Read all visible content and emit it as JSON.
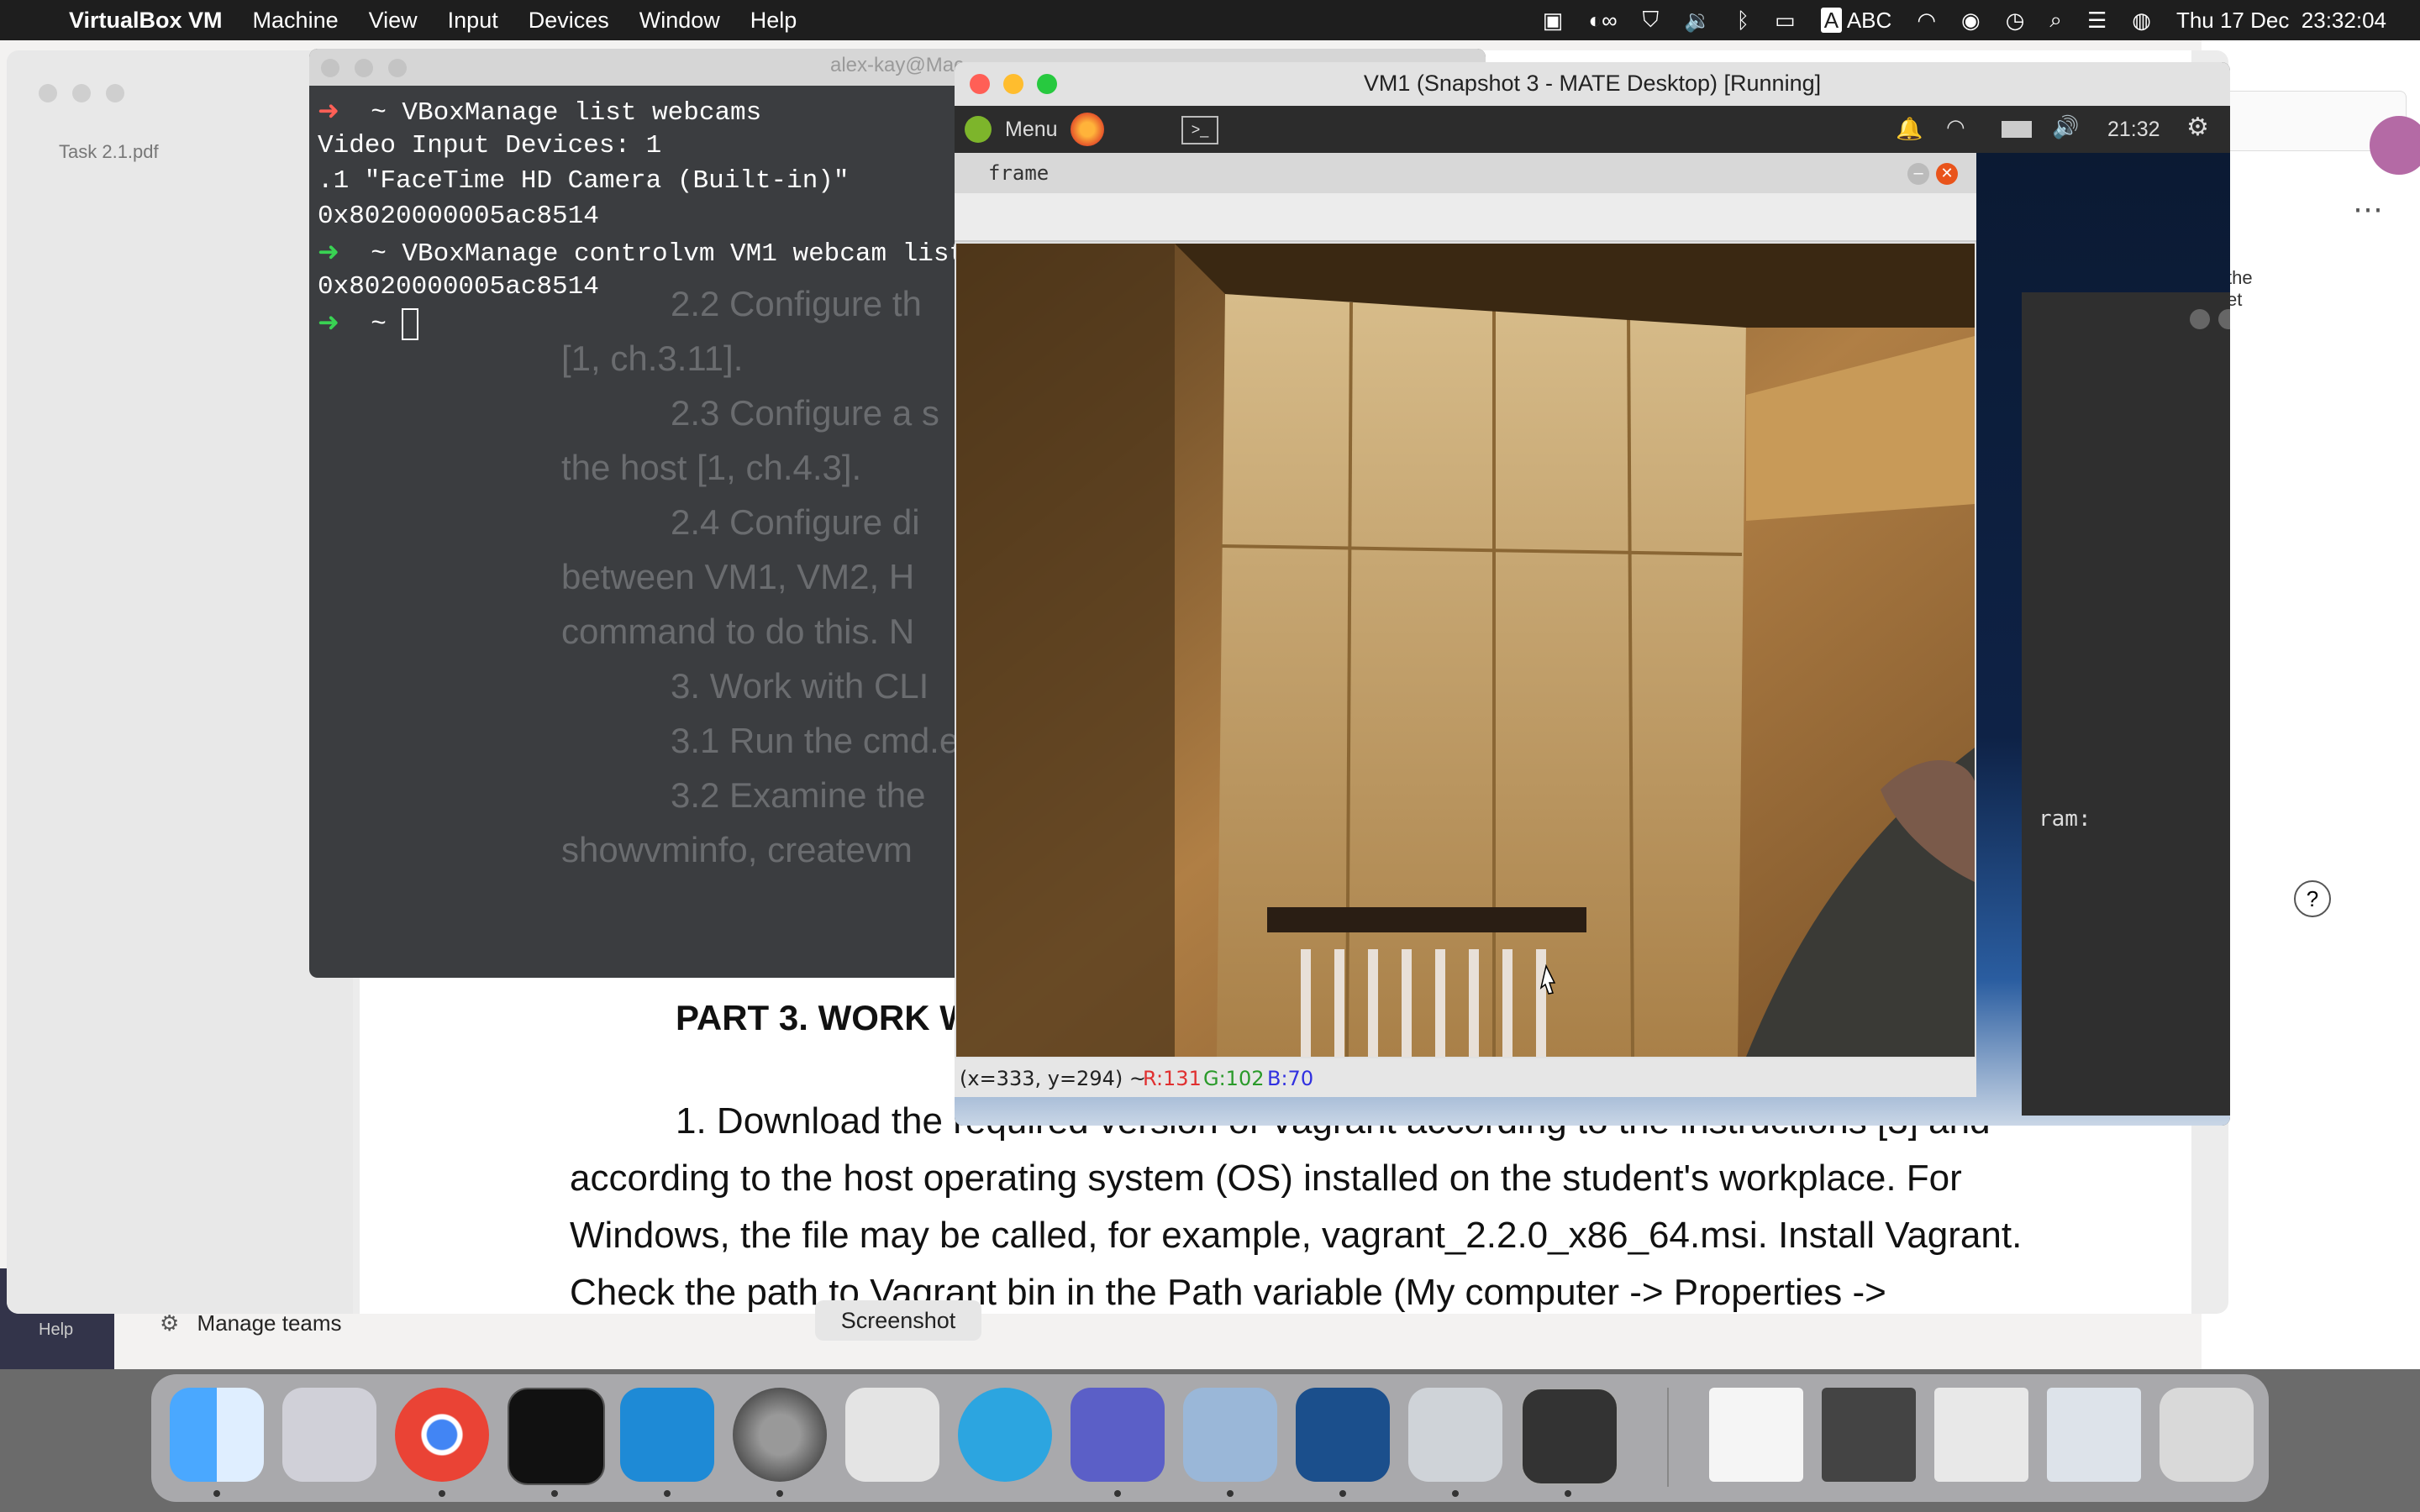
{
  "menubar": {
    "app_name": "VirtualBox VM",
    "menus": [
      "Machine",
      "View",
      "Input",
      "Devices",
      "Window",
      "Help"
    ],
    "input_source": "ABC",
    "datetime": "Thu 17 Dec  23:32:04"
  },
  "pdf": {
    "file_name": "Task 2.1.pdf",
    "heading": "PART 3. WORK W",
    "body_lines": [
      "1. Download the required version of Vagrant according to the instructions [3] and",
      "according to the host operating system (OS) installed on the student's workplace. For",
      "Windows, the file may be called, for example, vagrant_2.2.0_x86_64.msi. Install Vagrant.",
      "Check the path to Vagrant bin in the Path variable (My computer -> Properties ->"
    ],
    "ghost_lines": [
      "2.2 Configure th",
      "[1, ch.3.11].",
      "2.3 Configure a s",
      "the host [1, ch.4.3].",
      "2.4 Configure di",
      "between VM1, VM2, H",
      "command to do this. N",
      "3. Work with CLI",
      "3.1 Run the cmd.e",
      "3.2 Examine the",
      "showvminfo, createvm"
    ]
  },
  "terminal": {
    "title": "alex-kay@Mac...",
    "lines": [
      {
        "prompt": "➜",
        "text": "  ~ VBoxManage list webcams"
      },
      {
        "prompt": "",
        "text": "Video Input Devices: 1"
      },
      {
        "prompt": "",
        "text": ".1 \"FaceTime HD Camera (Built-in)\""
      },
      {
        "prompt": "",
        "text": "0x8020000005ac8514"
      },
      {
        "prompt": "➜",
        "text": "  ~ VBoxManage controlvm VM1 webcam list"
      },
      {
        "prompt": "",
        "text": "0x8020000005ac8514"
      },
      {
        "prompt": "➜",
        "text": "  ~ "
      }
    ]
  },
  "vm": {
    "title": "VM1 (Snapshot 3 - MATE Desktop) [Running]",
    "panel_menu": "Menu",
    "panel_time": "21:32",
    "back_window_text": "ram:",
    "frame": {
      "title": "frame",
      "status_coords": "(x=333, y=294) ~ ",
      "status_r": "R:131",
      "status_g": "G:102",
      "status_b": "B:70"
    }
  },
  "teams": {
    "manage_teams": "Manage teams",
    "help": "Help",
    "side_text": "the\net"
  },
  "dock": {
    "tooltip": "Screenshot",
    "apps": [
      "Finder",
      "Launchpad",
      "Google Chrome",
      "Terminal",
      "Visual Studio Code",
      "System Preferences",
      "Screenshot",
      "Telegram",
      "Microsoft Teams",
      "Preview",
      "VirtualBox",
      "Disk Utility",
      "VirtualBox VM",
      "Document",
      "Document",
      "Document",
      "Document",
      "Trash"
    ]
  },
  "colors": {
    "menubar": "#1e1e1e",
    "prompt_green": "#39d353",
    "prompt_red": "#ff5f56",
    "status_red": "#e03030",
    "status_green": "#2a9a2a",
    "status_blue": "#3030e0"
  }
}
